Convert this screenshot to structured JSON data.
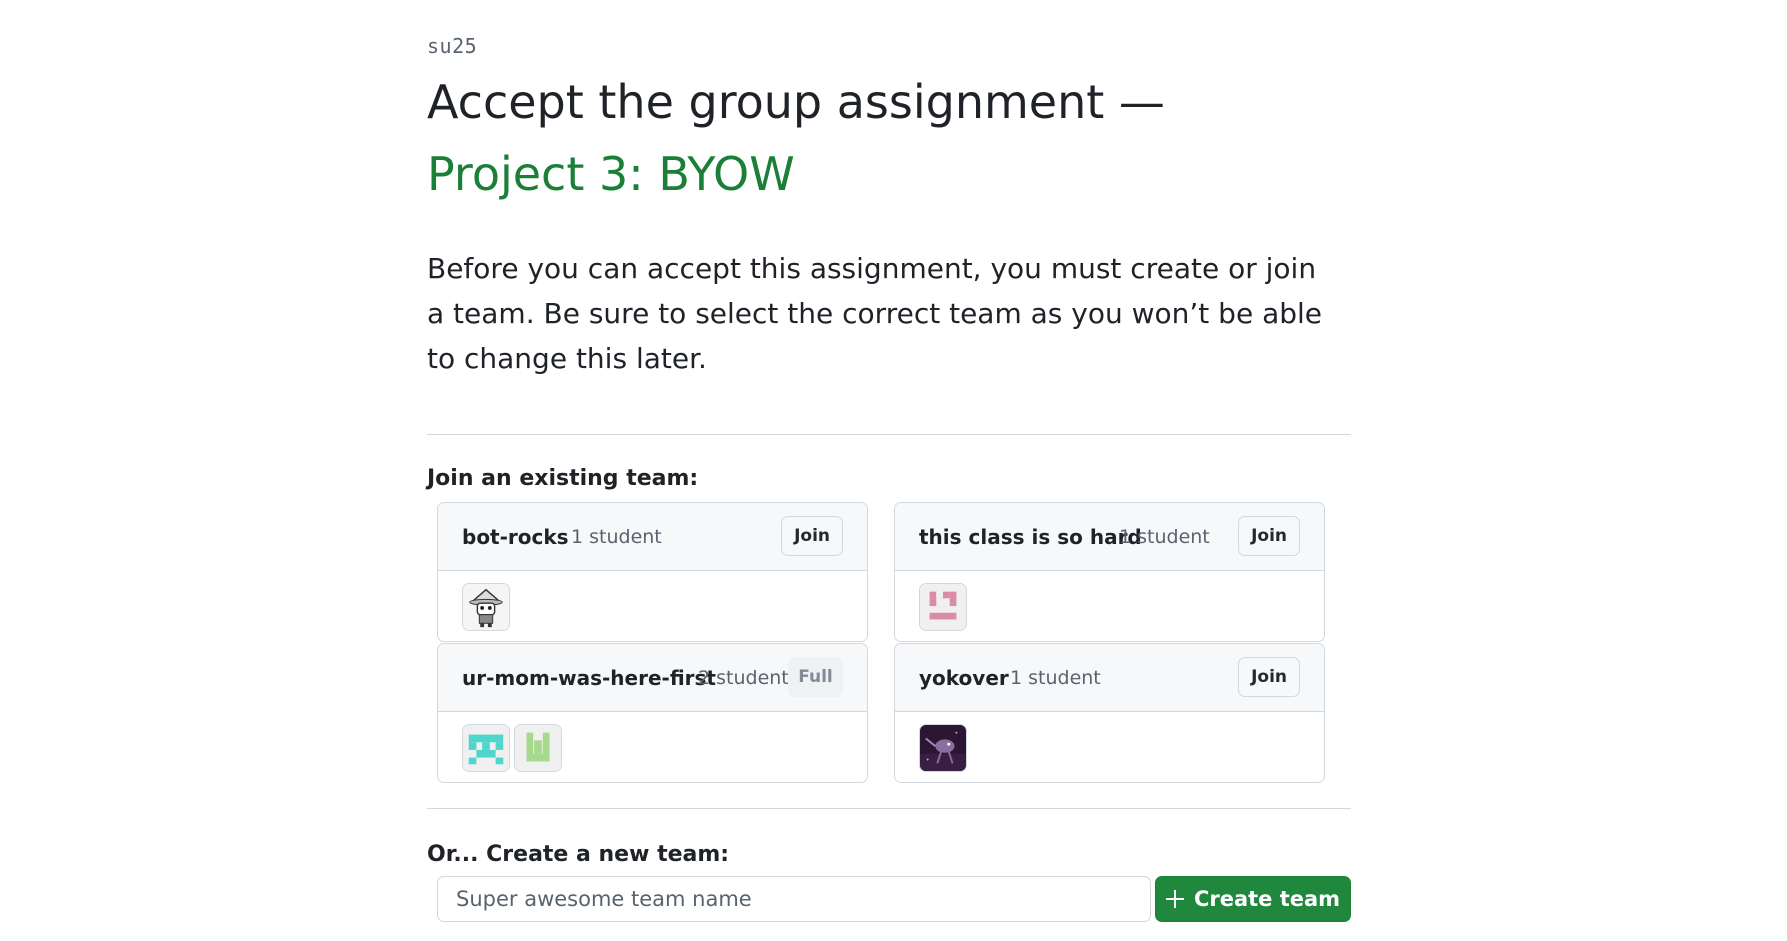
{
  "classroom_label": "su25",
  "title_prefix": "Accept the group assignment —",
  "assignment_name": "Project 3: BYOW",
  "intro_text": "Before you can accept this assignment, you must create or join a team. Be sure to select the correct team as you won’t be able to change this later.",
  "join_heading": "Join an existing team:",
  "teams": [
    {
      "name": "bot-rocks",
      "count": "1 student",
      "action": "Join",
      "avatars": [
        "robot-hat-avatar"
      ]
    },
    {
      "name": "this class is so hard",
      "count": "1 student",
      "action": "Join",
      "avatars": [
        "pink-identicon-avatar"
      ]
    },
    {
      "name": "ur-mom-was-here-first",
      "count": "2 students",
      "action": "Full",
      "avatars": [
        "teal-identicon-avatar",
        "green-identicon-avatar"
      ]
    },
    {
      "name": "yokover",
      "count": "1 student",
      "action": "Join",
      "avatars": [
        "purple-creature-avatar"
      ]
    }
  ],
  "create_heading": "Or... Create a new team:",
  "create_input": {
    "value": "",
    "placeholder": "Super awesome team name"
  },
  "create_button": "Create team",
  "colors": {
    "accent_green": "#1a7f37",
    "button_green": "#1f883d",
    "muted_text": "#59636e",
    "border": "#d1d9e0"
  }
}
